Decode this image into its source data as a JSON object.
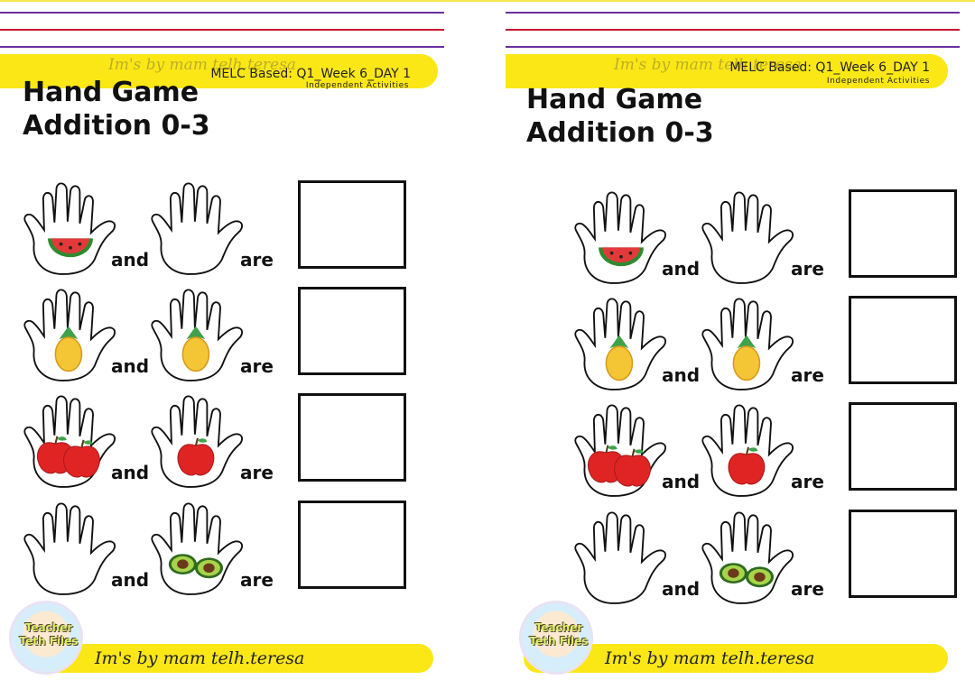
{
  "header": {
    "melc_label": "MELC Based: Q1_Week 6_DAY 1",
    "subheading": "Independent Activities",
    "watermark": "Im's by mam telh.teresa"
  },
  "title": {
    "line1": "Hand Game",
    "line2": "Addition 0-3"
  },
  "words": {
    "and": "and",
    "are": "are"
  },
  "rows": [
    {
      "left_fruit": "watermelon",
      "left_count": 1,
      "right_fruit": "none",
      "right_count": 0
    },
    {
      "left_fruit": "pineapple",
      "left_count": 1,
      "right_fruit": "pineapple",
      "right_count": 1
    },
    {
      "left_fruit": "apple",
      "left_count": 2,
      "right_fruit": "apple",
      "right_count": 1
    },
    {
      "left_fruit": "none",
      "left_count": 0,
      "right_fruit": "avocado",
      "right_count": 2
    }
  ],
  "footer": {
    "badge": "Teacher Teth Files",
    "signature": "Im's by mam telh.teresa"
  },
  "colors": {
    "band_yellow": "#fbe716",
    "rule_purple": "#6a2fa0",
    "rule_red": "#c8102e"
  }
}
